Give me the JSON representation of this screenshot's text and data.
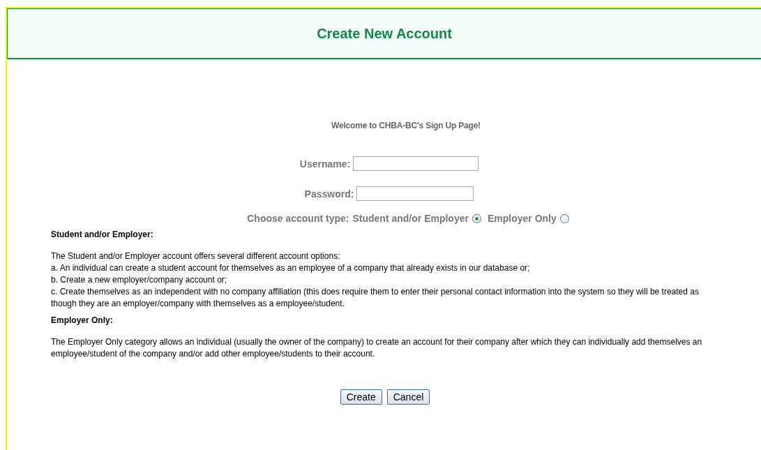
{
  "header": {
    "title": "Create New Account"
  },
  "welcome": "Welcome to CHBA-BC's Sign Up Page!",
  "fields": [
    {
      "label": "Username:",
      "kind": "text"
    },
    {
      "label": "Password:",
      "kind": "password"
    }
  ],
  "account_type": {
    "label": "Choose account type:",
    "options": [
      {
        "label": "Student and/or Employer",
        "selected": true
      },
      {
        "label": "Employer Only",
        "selected": false
      }
    ]
  },
  "sections": [
    {
      "heading": "Student and/or Employer:",
      "lines": [
        "The Student and/or Employer account offers several different account options:",
        "a. An individual can create a student account for themselves as an employee of a company that already exists in our database or;",
        "b. Create a new employer/company account or;",
        "c. Create themselves as an independent with no company affiliation (this does require them to enter their personal contact information into the system so they will be treated as though they are an employer/company with themselves as a employee/student."
      ]
    },
    {
      "heading": "Employer Only:",
      "lines": [
        "The Employer Only category allows an individual (usually the owner of the company) to create an account for their company after which they can individually add themselves an employee/student of the company and/or add other employee/students to their account."
      ]
    }
  ],
  "buttons": [
    "Create",
    "Cancel"
  ]
}
